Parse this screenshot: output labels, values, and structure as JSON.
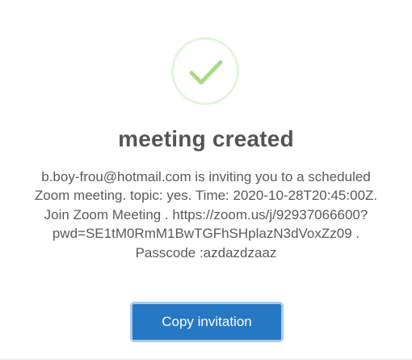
{
  "dialog": {
    "icon": "success-check-icon",
    "title": "meeting created",
    "message": "b.boy-frou@hotmail.com is inviting you to a scheduled Zoom meeting. topic: yes. Time: 2020-10-28T20:45:00Z. Join Zoom Meeting . https://zoom.us/j/92937066600?pwd=SE1tM0RmM1BwTGFhSHplazN3dVoxZz09 . Passcode :azdazdzaaz",
    "copy_button_label": "Copy invitation"
  },
  "colors": {
    "success_green": "#a5dc86",
    "success_ring": "#e3f4dd",
    "button_blue": "#2778c4",
    "button_focus_ring": "#a9c9ec",
    "title_text": "#555555",
    "body_text": "#5a5a5a"
  }
}
